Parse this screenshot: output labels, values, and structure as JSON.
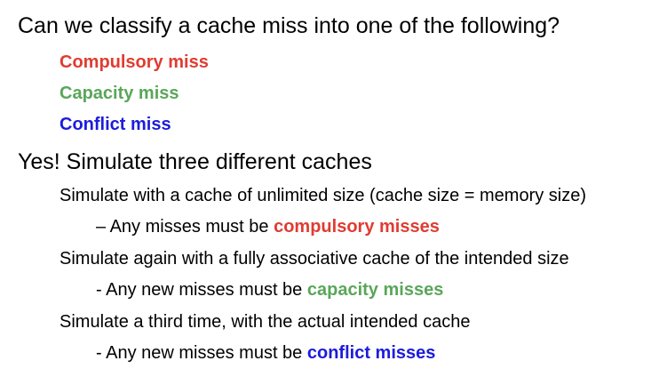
{
  "colors": {
    "compulsory": "#e03c31",
    "capacity": "#5aa65a",
    "conflict": "#1c1cdc",
    "text": "#000000"
  },
  "question": "Can we classify a cache miss into one of the following?",
  "categories": [
    "Compulsory miss",
    "Capacity miss",
    "Conflict miss"
  ],
  "answer": "Yes! Simulate three different caches",
  "steps": [
    {
      "text": "Simulate with a cache of unlimited size (cache size = memory size)",
      "result_prefix": "– Any misses must be ",
      "result_term": "compulsory misses"
    },
    {
      "text": "Simulate again with a fully associative cache of the intended size",
      "result_prefix": "- Any new misses must be ",
      "result_term": "capacity misses"
    },
    {
      "text": "Simulate a third time, with the actual intended cache",
      "result_prefix": "- Any new misses must be ",
      "result_term": "conflict misses"
    }
  ]
}
